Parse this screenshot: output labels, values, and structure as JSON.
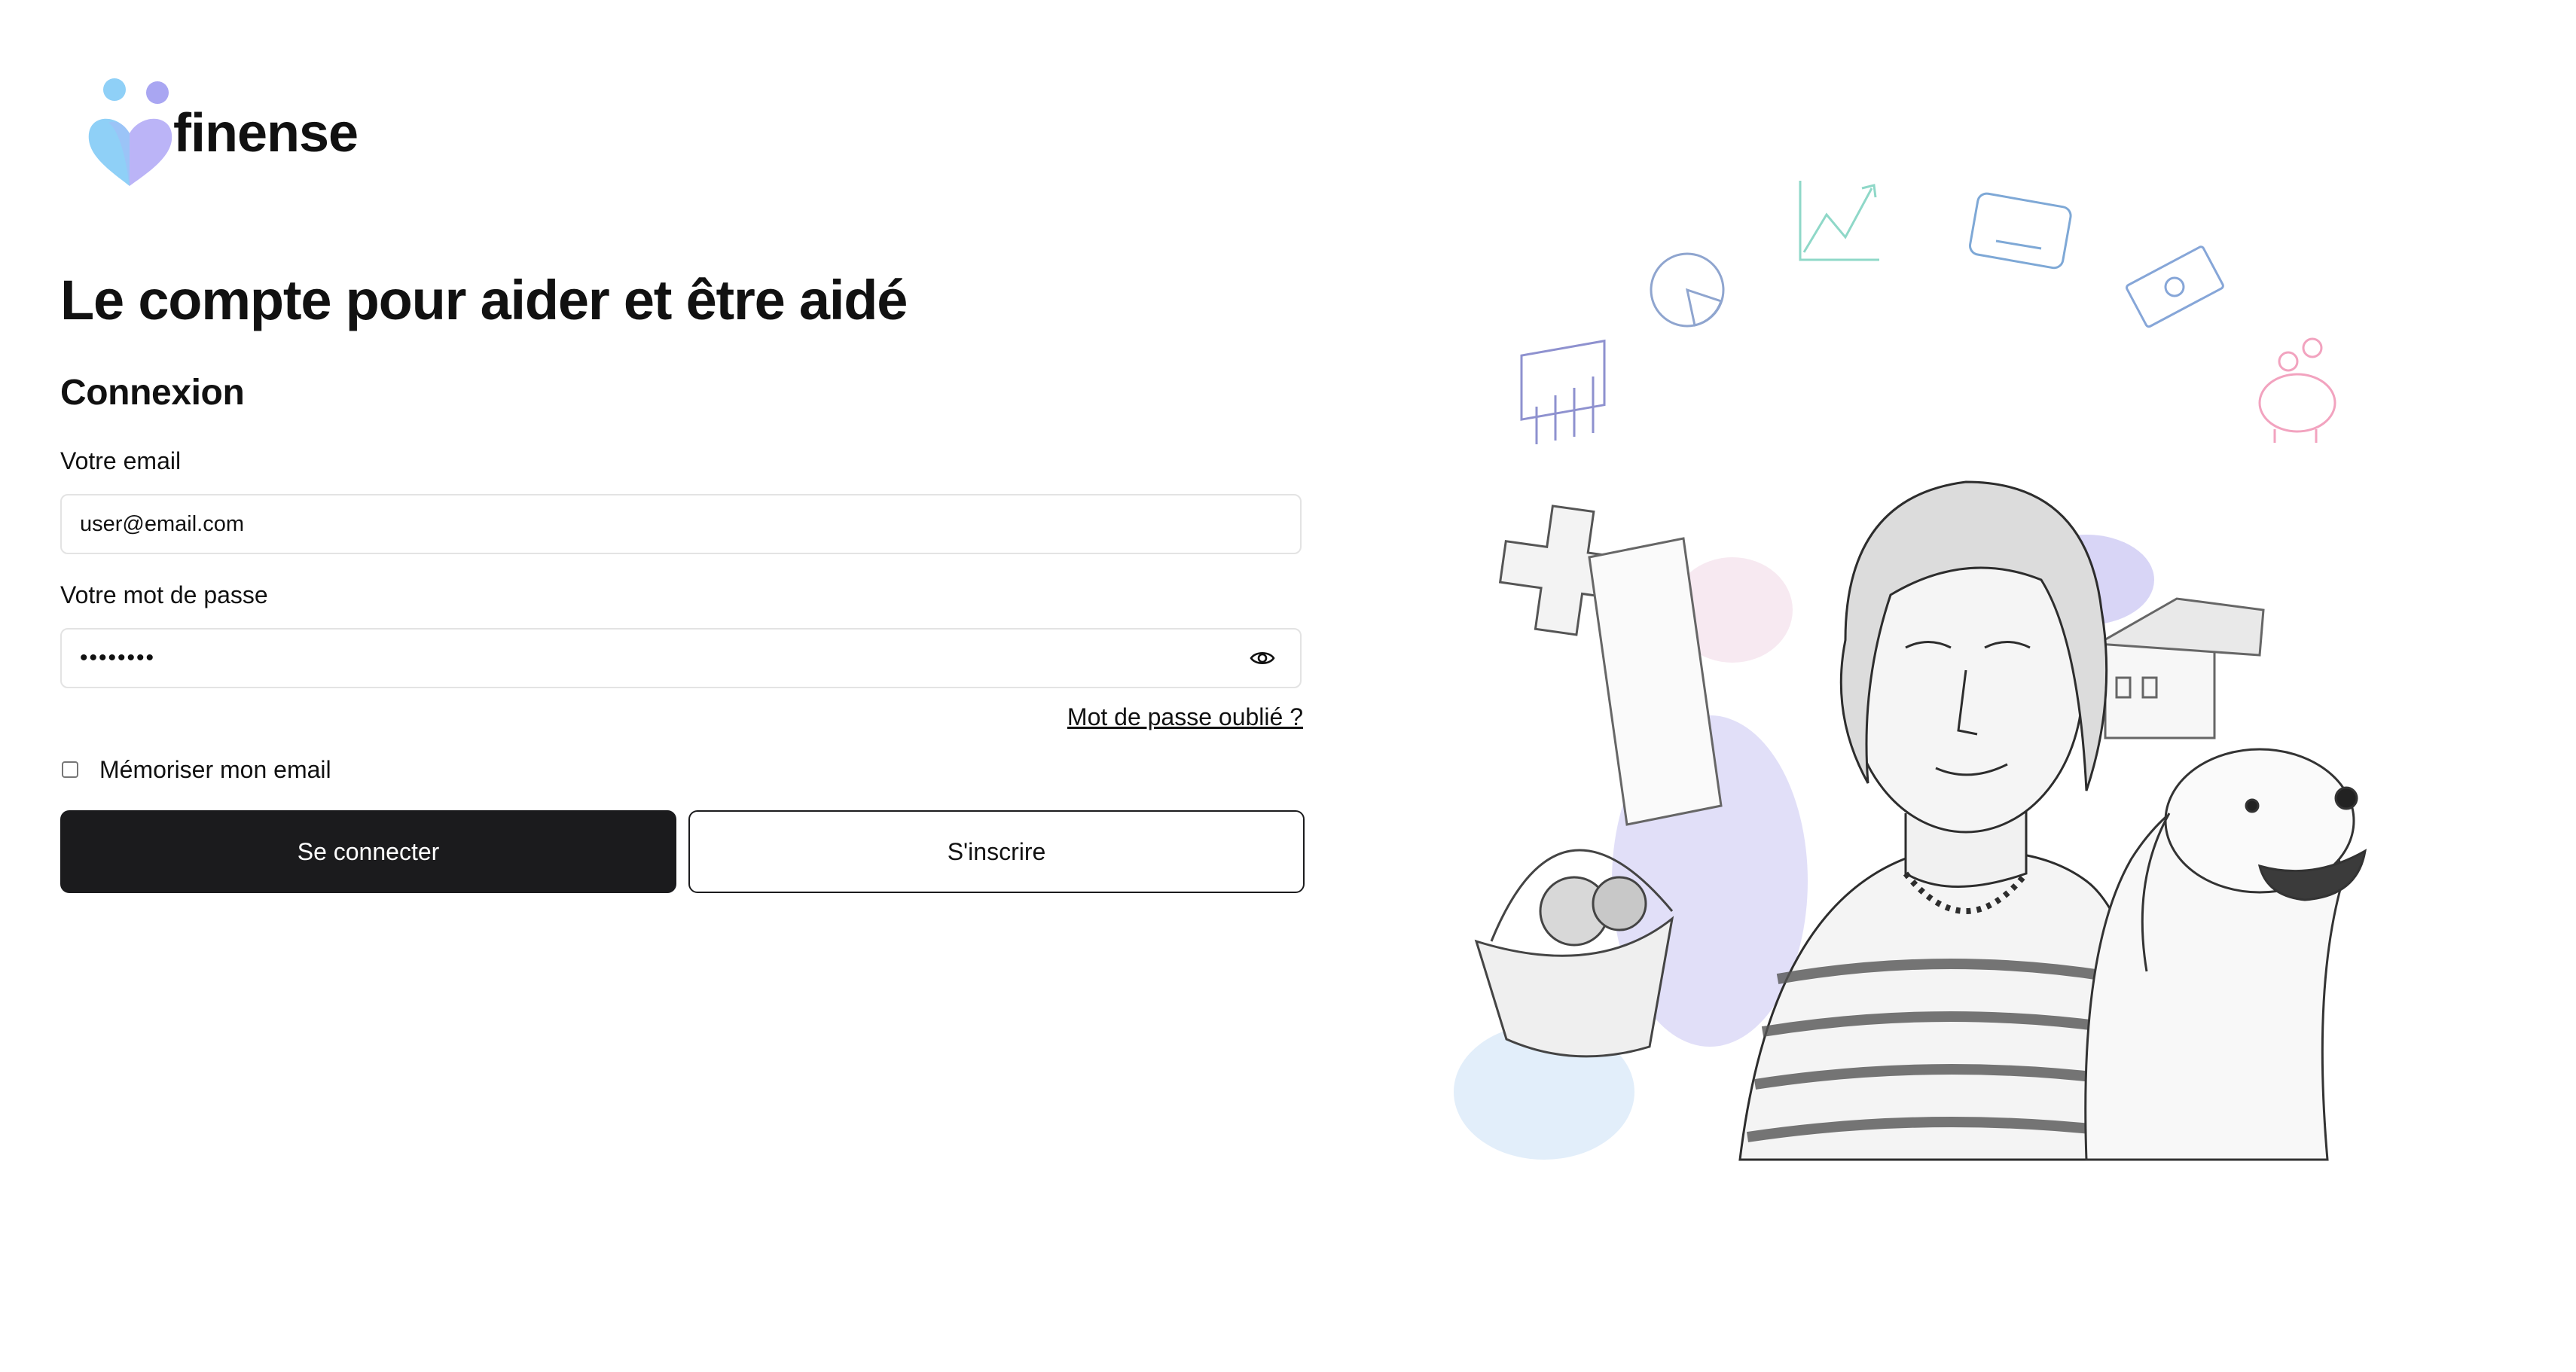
{
  "brand": {
    "name": "finense",
    "colors": {
      "heart_left": "#8fd0f7",
      "heart_right": "#b7b0f7",
      "dot_left": "#8fd0f7",
      "dot_right": "#a9a6f2"
    }
  },
  "hero": {
    "headline": "Le compte pour aider et être aidé"
  },
  "login": {
    "title": "Connexion",
    "email_label": "Votre email",
    "email_value": "user@email.com",
    "password_label": "Votre mot de passe",
    "password_value": "••••••••",
    "toggle_visibility_icon": "eye-icon",
    "forgot_password": "Mot de passe oublié ?",
    "remember_label": "Mémoriser mon email",
    "remember_checked": false,
    "submit_label": "Se connecter",
    "signup_label": "S'inscrire"
  },
  "colors": {
    "primary_button": "#1b1b1d",
    "input_border": "#e3e3e3",
    "illustration_accent_blue": "#9fc9f0",
    "illustration_accent_purple": "#a9a2ec",
    "illustration_accent_pink": "#f2a3bf"
  }
}
